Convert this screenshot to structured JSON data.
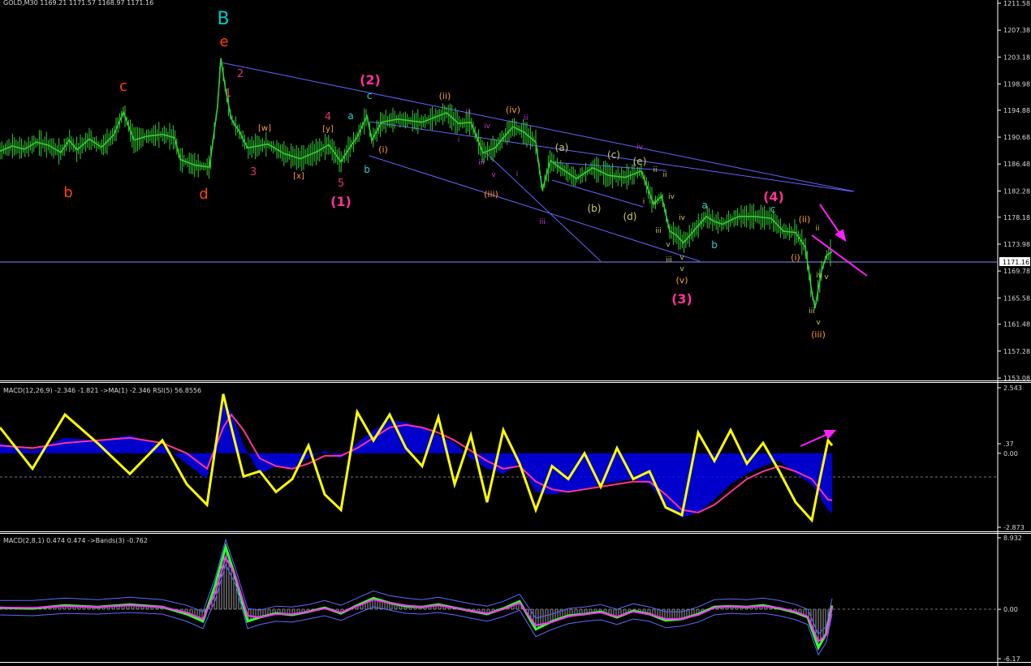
{
  "window": {
    "title": "GOLD,M30 1169.21 1171.57 1168.97 1171.16"
  },
  "colors": {
    "background": "#000000",
    "axis": "#ffffff",
    "candles": "#32cd32",
    "trendlines": "#6464ff",
    "macd_histogram": "#0000ff",
    "macd_signal": "#ff3399",
    "rsi": "#ffff00",
    "macd2_line": "#33ff33",
    "macd2_signal": "#ff33ff",
    "bands": "#5b6bff",
    "arrows": "#ff22ff"
  },
  "chart_data": [
    {
      "type": "line",
      "name": "price-panel",
      "header": "GOLD,M30 1169.21 1171.57 1168.97 1171.16",
      "y_ticks": [
        "1211.58",
        "1207.38",
        "1203.18",
        "1198.98",
        "1194.88",
        "1190.68",
        "1186.48",
        "1182.28",
        "1178.18",
        "1173.98",
        "1171.16",
        "1169.78",
        "1165.58",
        "1161.48",
        "1157.28",
        "1153.08"
      ],
      "ylim": [
        1153.08,
        1211.58
      ],
      "current_price": "1171.16",
      "x": [
        0,
        15,
        30,
        45,
        60,
        75,
        85,
        95,
        110,
        125,
        140,
        152,
        165,
        180,
        200,
        215,
        222,
        240,
        258,
        268,
        272,
        278,
        285,
        295,
        305,
        330,
        350,
        370,
        390,
        405,
        420,
        430,
        440,
        452,
        458,
        470,
        490,
        520,
        550,
        565,
        580,
        595,
        610,
        620,
        632,
        645,
        660,
        668,
        678,
        690,
        710,
        730,
        750,
        770,
        790,
        805,
        815,
        825,
        833,
        842,
        855,
        870,
        880,
        890,
        910,
        930,
        950,
        965,
        980,
        992,
        1000,
        1004,
        1008,
        1012,
        1018,
        1025
      ],
      "y": [
        1188.5,
        1189.3,
        1188.8,
        1189.9,
        1189.4,
        1188.3,
        1190.2,
        1188.7,
        1190.4,
        1189.1,
        1191.0,
        1194.6,
        1190.2,
        1190.8,
        1191.1,
        1190.6,
        1187.2,
        1186.3,
        1186.0,
        1195.5,
        1203.0,
        1198.0,
        1193.5,
        1191.5,
        1189.0,
        1189.6,
        1188.1,
        1187.3,
        1188.4,
        1189.5,
        1186.8,
        1188.9,
        1190.7,
        1194.0,
        1190.2,
        1193.0,
        1193.5,
        1193.0,
        1194.5,
        1192.8,
        1193.0,
        1188.2,
        1189.0,
        1190.6,
        1192.3,
        1191.5,
        1189.9,
        1182.4,
        1187.0,
        1185.9,
        1184.2,
        1185.9,
        1184.7,
        1184.4,
        1185.4,
        1180.2,
        1181.5,
        1176.0,
        1175.4,
        1174.2,
        1176.1,
        1178.3,
        1177.5,
        1177.1,
        1178.3,
        1178.3,
        1178.0,
        1176.0,
        1175.8,
        1173.5,
        1166.5,
        1164.0,
        1167.0,
        1169.8,
        1172.2,
        1172.8
      ],
      "annotations": {
        "wave_B": "B",
        "wave_b": "b",
        "wave_c": "c",
        "wave_d": "d",
        "wave_e": "e",
        "w1": "1",
        "w2": "2",
        "w3": "3",
        "w4": "4",
        "w5": "5",
        "W1": "(1)",
        "W2": "(2)",
        "W3": "(3)",
        "W4": "(4)",
        "sw": "[w]",
        "sx": "[x]",
        "sy": "[y]",
        "ra": "a",
        "rb": "b",
        "rc": "c",
        "ri": "(i)",
        "rii": "(ii)",
        "riii": "(iii)",
        "riv": "(iv)",
        "rv": "(v)",
        "pa": "(a)",
        "pb": "(b)",
        "pc": "(c)",
        "pd": "(d)",
        "pe": "(e)",
        "ma": "a",
        "mb": "b",
        "mc": "c",
        "ri2": "(i)",
        "rii2": "(ii)",
        "riii2": "(iii)",
        "mi": "i",
        "mii": "ii",
        "miii": "iii",
        "miv": "iv",
        "mv": "v"
      }
    },
    {
      "type": "line",
      "name": "macd-rsi-panel",
      "header": "MACD(12,26,9) -2.346 -1.821  ->MA(1) -2.346  RSI(5) 56.8556",
      "y_ticks": [
        "2.543",
        "0.00",
        ".37",
        "-2.873"
      ],
      "ylim": [
        -2.873,
        2.543
      ],
      "x": [
        0,
        40,
        80,
        120,
        160,
        200,
        230,
        255,
        275,
        285,
        300,
        320,
        340,
        360,
        380,
        400,
        420,
        440,
        460,
        480,
        500,
        520,
        540,
        560,
        580,
        600,
        620,
        640,
        660,
        680,
        700,
        720,
        740,
        760,
        780,
        800,
        820,
        840,
        860,
        880,
        900,
        920,
        940,
        960,
        980,
        1000,
        1010,
        1020,
        1025
      ],
      "series": [
        {
          "name": "MACD",
          "values": [
            0.4,
            0.1,
            0.6,
            0.5,
            0.7,
            0.3,
            -0.4,
            -1.0,
            2.0,
            1.6,
            0.3,
            -0.8,
            -0.5,
            -0.6,
            -0.2,
            0.1,
            -0.2,
            0.4,
            0.9,
            1.3,
            1.2,
            1.0,
            0.7,
            0.4,
            -0.2,
            -0.6,
            -0.8,
            -0.4,
            -1.5,
            -1.6,
            -1.5,
            -1.4,
            -1.2,
            -1.1,
            -1.0,
            -1.2,
            -2.0,
            -2.5,
            -2.3,
            -1.8,
            -1.2,
            -0.8,
            -0.5,
            -0.3,
            -0.8,
            -1.2,
            -1.7,
            -2.2,
            -2.35
          ]
        },
        {
          "name": "Signal",
          "values": [
            0.3,
            0.2,
            0.4,
            0.5,
            0.6,
            0.4,
            0.0,
            -0.6,
            1.0,
            1.5,
            0.9,
            -0.2,
            -0.5,
            -0.6,
            -0.4,
            -0.1,
            -0.1,
            0.2,
            0.6,
            1.0,
            1.1,
            1.0,
            0.8,
            0.5,
            0.1,
            -0.3,
            -0.6,
            -0.5,
            -1.1,
            -1.4,
            -1.5,
            -1.4,
            -1.3,
            -1.2,
            -1.1,
            -1.1,
            -1.6,
            -2.2,
            -2.3,
            -2.0,
            -1.5,
            -1.0,
            -0.7,
            -0.5,
            -0.7,
            -1.0,
            -1.4,
            -1.8,
            -1.82
          ]
        },
        {
          "name": "RSI",
          "values": [
            1.0,
            -0.6,
            1.5,
            0.4,
            -0.8,
            0.5,
            -1.2,
            -2.0,
            2.3,
            1.0,
            -0.9,
            -0.7,
            -1.5,
            -1.0,
            0.3,
            -1.6,
            -2.2,
            1.6,
            0.5,
            1.5,
            0.2,
            -0.5,
            1.4,
            -1.2,
            0.7,
            -1.9,
            0.9,
            -0.4,
            -2.2,
            -0.5,
            -1.0,
            0.0,
            -1.3,
            0.2,
            -1.0,
            -0.7,
            -2.1,
            -2.4,
            0.8,
            -0.3,
            0.9,
            -0.4,
            0.4,
            -0.7,
            -1.9,
            -2.6,
            -1.0,
            0.5,
            0.3
          ]
        }
      ]
    },
    {
      "type": "line",
      "name": "macd2-panel",
      "header": "MACD(2,8,1) 0.474 0.474  ->Bands(3) -0.762",
      "y_ticks": [
        "8.932",
        "0.00",
        "-6.17"
      ],
      "ylim": [
        -6.17,
        8.932
      ],
      "x": [
        0,
        40,
        80,
        120,
        160,
        200,
        230,
        250,
        265,
        278,
        290,
        305,
        320,
        340,
        360,
        380,
        400,
        420,
        440,
        460,
        480,
        500,
        520,
        540,
        560,
        580,
        600,
        620,
        640,
        660,
        680,
        700,
        720,
        740,
        760,
        780,
        800,
        820,
        840,
        860,
        880,
        900,
        920,
        940,
        960,
        980,
        995,
        1008,
        1018,
        1025
      ],
      "series": [
        {
          "name": "MACD",
          "values": [
            0.2,
            0.1,
            0.5,
            0.3,
            0.6,
            0.3,
            -0.6,
            -1.5,
            3.0,
            7.8,
            4.0,
            -1.5,
            -1.0,
            -0.5,
            -0.7,
            -0.3,
            0.2,
            -0.5,
            0.5,
            1.4,
            0.8,
            0.4,
            0.3,
            0.6,
            0.2,
            -0.2,
            -0.6,
            0.1,
            1.0,
            -2.5,
            -1.5,
            -0.8,
            -0.6,
            -0.3,
            -1.0,
            -0.2,
            -0.6,
            -1.4,
            -1.2,
            -0.6,
            0.3,
            0.4,
            0.3,
            0.5,
            0.1,
            -0.4,
            -1.0,
            -4.8,
            -3.0,
            0.47
          ]
        },
        {
          "name": "Signal",
          "values": [
            0.2,
            0.2,
            0.4,
            0.3,
            0.5,
            0.3,
            -0.4,
            -1.2,
            2.0,
            6.5,
            4.2,
            -0.8,
            -1.0,
            -0.6,
            -0.6,
            -0.3,
            0.1,
            -0.4,
            0.4,
            1.2,
            0.8,
            0.5,
            0.3,
            0.5,
            0.2,
            -0.2,
            -0.5,
            0.0,
            0.8,
            -2.0,
            -1.6,
            -0.9,
            -0.6,
            -0.4,
            -0.9,
            -0.3,
            -0.6,
            -1.2,
            -1.2,
            -0.7,
            0.2,
            0.4,
            0.3,
            0.4,
            0.2,
            -0.3,
            -0.9,
            -4.0,
            -3.2,
            0.3
          ]
        }
      ]
    }
  ]
}
